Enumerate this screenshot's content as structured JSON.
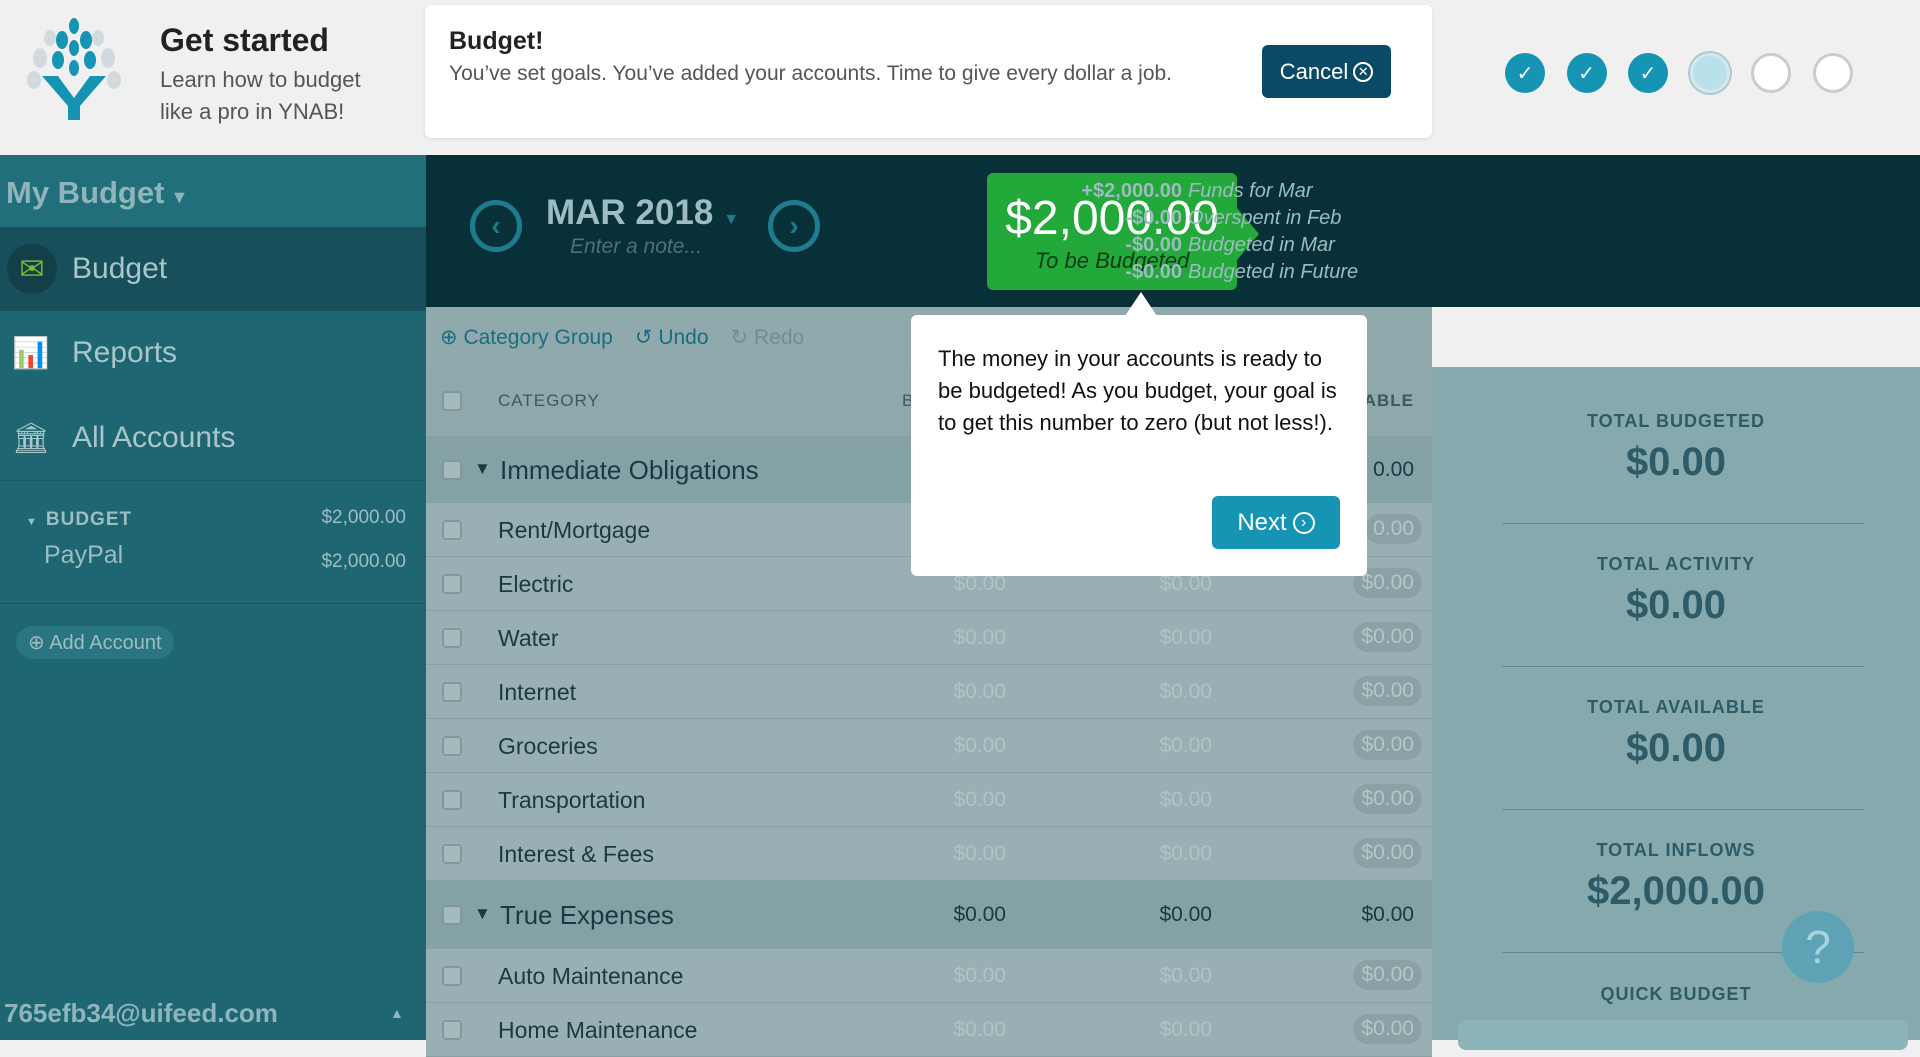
{
  "onboarding": {
    "title": "Get started",
    "subtitle": "Learn how to budget like a pro in YNAB!",
    "step_title": "Budget!",
    "step_text": "You’ve set goals. You’ve added your accounts. Time to give every dollar a job.",
    "cancel_label": "Cancel",
    "steps": [
      "done",
      "done",
      "done",
      "current",
      "todo",
      "todo"
    ]
  },
  "sidebar": {
    "budget_name": "My Budget",
    "nav": [
      {
        "label": "Budget",
        "icon": "envelope-icon"
      },
      {
        "label": "Reports",
        "icon": "bar-chart-icon"
      },
      {
        "label": "All Accounts",
        "icon": "bank-icon"
      }
    ],
    "account_group": {
      "label": "BUDGET",
      "balance": "$2,000.00"
    },
    "accounts": [
      {
        "name": "PayPal",
        "balance": "$2,000.00"
      }
    ],
    "add_account": "Add Account",
    "email": "765efb34@uifeed.com"
  },
  "header": {
    "month": "MAR 2018",
    "note_placeholder": "Enter a note...",
    "to_be_budgeted": "$2,000.00",
    "to_be_budgeted_label": "To be Budgeted",
    "summary": [
      {
        "amount": "+$2,000.00",
        "label": "Funds for Mar"
      },
      {
        "amount": "-$0.00",
        "label": "Overspent in Feb"
      },
      {
        "amount": "-$0.00",
        "label": "Budgeted in Mar"
      },
      {
        "amount": "-$0.00",
        "label": "Budgeted in Future"
      }
    ],
    "accent": "#22a93a"
  },
  "toolbar": {
    "category_group": "Category Group",
    "undo": "Undo",
    "redo": "Redo"
  },
  "table": {
    "columns": {
      "category": "CATEGORY",
      "budgeted": "B",
      "available": "ABLE"
    },
    "rows": [
      {
        "type": "group",
        "name": "Immediate Obligations",
        "budgeted": "",
        "activity": "",
        "available": "0.00"
      },
      {
        "type": "cat",
        "name": "Rent/Mortgage",
        "budgeted": "",
        "activity": "",
        "available": "0.00"
      },
      {
        "type": "cat",
        "name": "Electric",
        "budgeted": "$0.00",
        "activity": "$0.00",
        "available": "$0.00"
      },
      {
        "type": "cat",
        "name": "Water",
        "budgeted": "$0.00",
        "activity": "$0.00",
        "available": "$0.00"
      },
      {
        "type": "cat",
        "name": "Internet",
        "budgeted": "$0.00",
        "activity": "$0.00",
        "available": "$0.00"
      },
      {
        "type": "cat",
        "name": "Groceries",
        "budgeted": "$0.00",
        "activity": "$0.00",
        "available": "$0.00"
      },
      {
        "type": "cat",
        "name": "Transportation",
        "budgeted": "$0.00",
        "activity": "$0.00",
        "available": "$0.00"
      },
      {
        "type": "cat",
        "name": "Interest & Fees",
        "budgeted": "$0.00",
        "activity": "$0.00",
        "available": "$0.00"
      },
      {
        "type": "group",
        "name": "True Expenses",
        "budgeted": "$0.00",
        "activity": "$0.00",
        "available": "$0.00"
      },
      {
        "type": "cat",
        "name": "Auto Maintenance",
        "budgeted": "$0.00",
        "activity": "$0.00",
        "available": "$0.00"
      },
      {
        "type": "cat",
        "name": "Home Maintenance",
        "budgeted": "$0.00",
        "activity": "$0.00",
        "available": "$0.00"
      }
    ]
  },
  "inspector": {
    "totals": [
      {
        "label": "TOTAL BUDGETED",
        "value": "$0.00"
      },
      {
        "label": "TOTAL ACTIVITY",
        "value": "$0.00"
      },
      {
        "label": "TOTAL AVAILABLE",
        "value": "$0.00"
      },
      {
        "label": "TOTAL INFLOWS",
        "value": "$2,000.00"
      }
    ],
    "quick_budget": "QUICK BUDGET"
  },
  "popover": {
    "text": "The money in your accounts is ready to be budgeted! As you budget, your goal is to get this number to zero (but not less!).",
    "next_label": "Next"
  },
  "help": {
    "label": "?"
  }
}
